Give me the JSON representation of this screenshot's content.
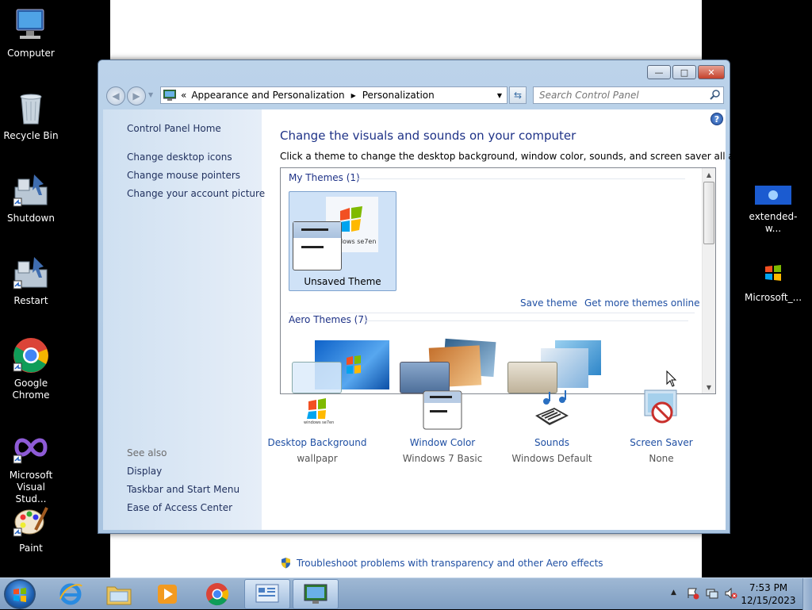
{
  "desktop": {
    "icons_left": [
      {
        "label": "Computer"
      },
      {
        "label": "Recycle Bin"
      },
      {
        "label": "Shutdown"
      },
      {
        "label": "Restart"
      },
      {
        "label": "Google\nChrome"
      },
      {
        "label": "Microsoft\nVisual Stud..."
      },
      {
        "label": "Paint"
      }
    ],
    "icons_right": [
      {
        "label": "extended-w..."
      },
      {
        "label": "Microsoft_..."
      }
    ]
  },
  "window": {
    "breadcrumb_prefix": "«",
    "breadcrumb": [
      "Appearance and Personalization",
      "Personalization"
    ],
    "search_placeholder": "Search Control Panel",
    "help_glyph": "?"
  },
  "left_pane": {
    "home": "Control Panel Home",
    "links": [
      "Change desktop icons",
      "Change mouse pointers",
      "Change your account picture"
    ],
    "see_also_heading": "See also",
    "see_also": [
      "Display",
      "Taskbar and Start Menu",
      "Ease of Access Center"
    ]
  },
  "main": {
    "title": "Change the visuals and sounds on your computer",
    "subtitle": "Click a theme to change the desktop background, window color, sounds, and screen saver all at once.",
    "my_themes_label": "My Themes (1)",
    "unsaved_theme_label": "Unsaved Theme",
    "thumb_logo_text": "dows se7en",
    "save_theme": "Save theme",
    "get_more": "Get more themes online",
    "aero_themes_label": "Aero Themes (7)",
    "settings": [
      {
        "name": "Desktop Background",
        "value": "wallpapr"
      },
      {
        "name": "Window Color",
        "value": "Windows 7 Basic"
      },
      {
        "name": "Sounds",
        "value": "Windows Default"
      },
      {
        "name": "Screen Saver",
        "value": "None"
      }
    ],
    "troubleshoot": "Troubleshoot problems with transparency and other Aero effects"
  },
  "taskbar": {
    "time": "7:53 PM",
    "date": "12/15/2023"
  },
  "colors": {
    "link": "#1f4fa3",
    "title": "#1e3287",
    "taskbar": "#8fabcc"
  }
}
